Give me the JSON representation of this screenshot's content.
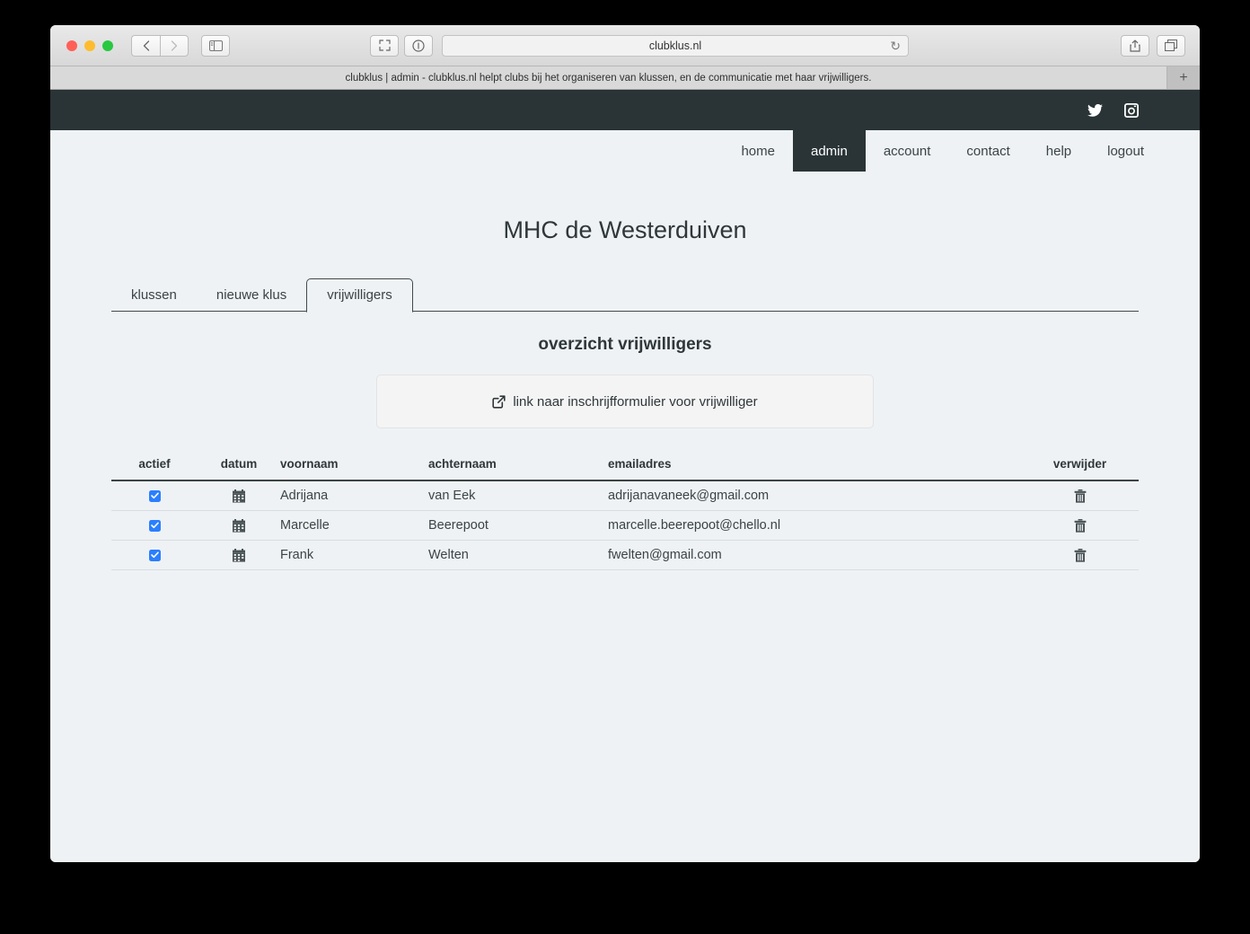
{
  "browser": {
    "url": "clubklus.nl",
    "tab_title": "clubklus | admin - clubklus.nl helpt clubs bij het organiseren van klussen, en de communicatie met haar vrijwilligers.",
    "new_tab_label": "+",
    "reload_icon": "reload-icon",
    "back_icon": "back-chevron-icon",
    "forward_icon": "forward-chevron-icon",
    "sidebar_icon": "sidebar-toggle-icon",
    "fullscreen_icon": "fullscreen-icon",
    "info_icon": "info-icon",
    "share_icon": "share-icon",
    "tabs_overview_icon": "tabs-overview-icon"
  },
  "topbar": {
    "twitter_icon": "twitter-icon",
    "instagram_icon": "instagram-icon"
  },
  "nav": {
    "items": [
      {
        "label": "home",
        "active": false
      },
      {
        "label": "admin",
        "active": true
      },
      {
        "label": "account",
        "active": false
      },
      {
        "label": "contact",
        "active": false
      },
      {
        "label": "help",
        "active": false
      },
      {
        "label": "logout",
        "active": false
      }
    ]
  },
  "page": {
    "title": "MHC de Westerduiven",
    "section_title": "overzicht vrijwilligers"
  },
  "content_tabs": [
    {
      "label": "klussen",
      "active": false
    },
    {
      "label": "nieuwe klus",
      "active": false
    },
    {
      "label": "vrijwilligers",
      "active": true
    }
  ],
  "link_panel": {
    "icon": "external-link-icon",
    "label": "link naar inschrijfformulier voor vrijwilliger"
  },
  "table": {
    "headers": [
      "actief",
      "datum",
      "voornaam",
      "achternaam",
      "emailadres",
      "verwijder"
    ],
    "rows": [
      {
        "actief": true,
        "datum_icon": "calendar-icon",
        "voornaam": "Adrijana",
        "achternaam": "van Eek",
        "emailadres": "adrijanavaneek@gmail.com",
        "verwijder_icon": "trash-icon"
      },
      {
        "actief": true,
        "datum_icon": "calendar-icon",
        "voornaam": "Marcelle",
        "achternaam": "Beerepoot",
        "emailadres": "marcelle.beerepoot@chello.nl",
        "verwijder_icon": "trash-icon"
      },
      {
        "actief": true,
        "datum_icon": "calendar-icon",
        "voornaam": "Frank",
        "achternaam": "Welten",
        "emailadres": "fwelten@gmail.com",
        "verwijder_icon": "trash-icon"
      }
    ]
  },
  "colors": {
    "dark": "#2a3436",
    "body_bg": "#eef2f5",
    "panel_bg": "#f4f4f5",
    "checkbox_blue": "#2a7fff",
    "text": "#3b4446"
  }
}
